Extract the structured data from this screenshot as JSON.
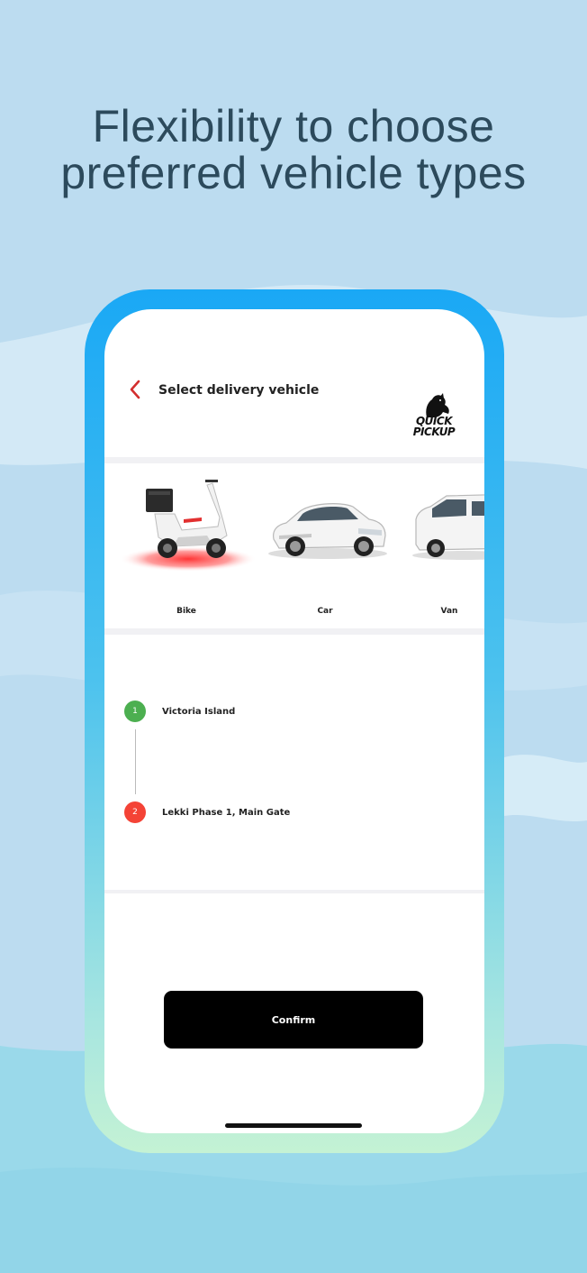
{
  "headline": {
    "line1": "Flexibility to choose",
    "line2": "preferred vehicle types"
  },
  "screen": {
    "title": "Select delivery vehicle",
    "logo_text_line1": "QUICK",
    "logo_text_line2": "PICKUP",
    "back_icon": "chevron-left-icon"
  },
  "vehicles": [
    {
      "label": "Bike",
      "icon": "scooter-image"
    },
    {
      "label": "Car",
      "icon": "sedan-image"
    },
    {
      "label": "Van",
      "icon": "van-image"
    }
  ],
  "route": {
    "stops": [
      {
        "number": "1",
        "name": "Victoria Island",
        "color": "#4caf50"
      },
      {
        "number": "2",
        "name": "Lekki Phase 1, Main Gate",
        "color": "#f44336"
      }
    ]
  },
  "actions": {
    "confirm_label": "Confirm"
  },
  "colors": {
    "accent_red": "#d32f2f",
    "frame_top": "#1aa8f5",
    "frame_bottom": "#c4f2d4",
    "background": "#bcdcf0",
    "headline": "#2c4a5c"
  }
}
